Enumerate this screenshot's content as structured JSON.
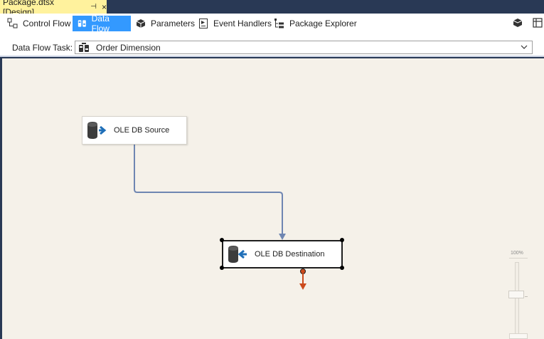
{
  "document": {
    "tab_title": "Package.dtsx [Design]",
    "pin_glyph": "⊣",
    "close_glyph": "×"
  },
  "designer_tabs": [
    {
      "label": "Control Flow",
      "icon": "control-flow-icon",
      "active": false
    },
    {
      "label": "Data Flow",
      "icon": "data-flow-icon",
      "active": true
    },
    {
      "label": "Parameters",
      "icon": "parameters-icon",
      "active": false
    },
    {
      "label": "Event Handlers",
      "icon": "event-handlers-icon",
      "active": false
    },
    {
      "label": "Package Explorer",
      "icon": "package-explorer-icon",
      "active": false
    }
  ],
  "task_selector": {
    "label": "Data Flow Task:",
    "value": "Order Dimension"
  },
  "components": {
    "source": {
      "label": "OLE DB Source",
      "icon": "database-source-icon"
    },
    "destination": {
      "label": "OLE DB Destination",
      "icon": "database-destination-icon",
      "selected": true
    }
  },
  "zoom": {
    "label": "100%",
    "level_percent": 100
  },
  "colors": {
    "active_tab": "#3399ff",
    "document_tab": "#fff29d",
    "canvas": "#f5f1e9",
    "data_path": "#6f86b2",
    "error_path": "#cc4a1c",
    "chrome": "#293955"
  }
}
